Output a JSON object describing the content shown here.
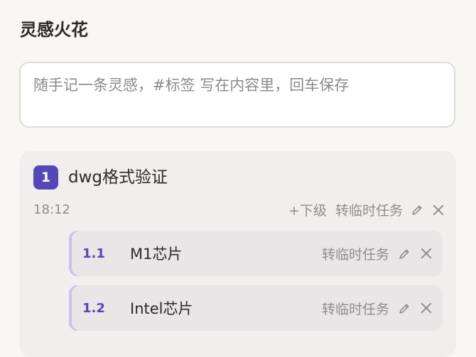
{
  "page": {
    "title": "灵感火花"
  },
  "input": {
    "placeholder": "随手记一条灵感，#标签 写在内容里，回车保存"
  },
  "card": {
    "index": "1",
    "title": "dwg格式验证",
    "time": "18:12",
    "actions": {
      "add_child": "+下级",
      "convert": "转临时任务"
    },
    "edit_icon": "pencil-icon",
    "close_icon": "close-icon",
    "children": [
      {
        "index": "1.1",
        "label": "M1芯片",
        "convert": "转临时任务"
      },
      {
        "index": "1.2",
        "label": "Intel芯片",
        "convert": "转临时任务"
      }
    ]
  },
  "colors": {
    "accent": "#5547b8",
    "card_bg": "#f0efed",
    "sub_bg": "#e8e6e6",
    "muted_text": "#8e8e8e"
  }
}
